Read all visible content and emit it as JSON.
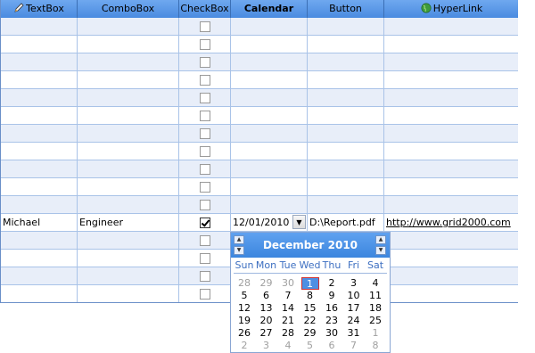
{
  "columns": [
    {
      "label": "TextBox",
      "icon": "pencil-icon"
    },
    {
      "label": "ComboBox"
    },
    {
      "label": "CheckBox"
    },
    {
      "label": "Calendar"
    },
    {
      "label": "Button"
    },
    {
      "label": "HyperLink",
      "icon": "globe-icon"
    }
  ],
  "data_row": {
    "textbox": "Michael",
    "combobox": "Engineer",
    "checked": true,
    "calendar": "12/01/2010",
    "button": "D:\\Report.pdf",
    "hyperlink": "http://www.grid2000.com"
  },
  "calendar_popup": {
    "month_title": "December 2010",
    "weekdays": [
      "Sun",
      "Mon",
      "Tue",
      "Wed",
      "Thu",
      "Fri",
      "Sat"
    ],
    "weeks": [
      [
        "28",
        "29",
        "30",
        "1",
        "2",
        "3",
        "4"
      ],
      [
        "5",
        "6",
        "7",
        "8",
        "9",
        "10",
        "11"
      ],
      [
        "12",
        "13",
        "14",
        "15",
        "16",
        "17",
        "18"
      ],
      [
        "19",
        "20",
        "21",
        "22",
        "23",
        "24",
        "25"
      ],
      [
        "26",
        "27",
        "28",
        "29",
        "30",
        "31",
        "1"
      ],
      [
        "2",
        "3",
        "4",
        "5",
        "6",
        "7",
        "8"
      ]
    ],
    "selected_day": "1"
  },
  "colors": {
    "header": "#4a8be0",
    "row_alt": "#e8eef9",
    "grid_line": "#a9c3e8"
  }
}
